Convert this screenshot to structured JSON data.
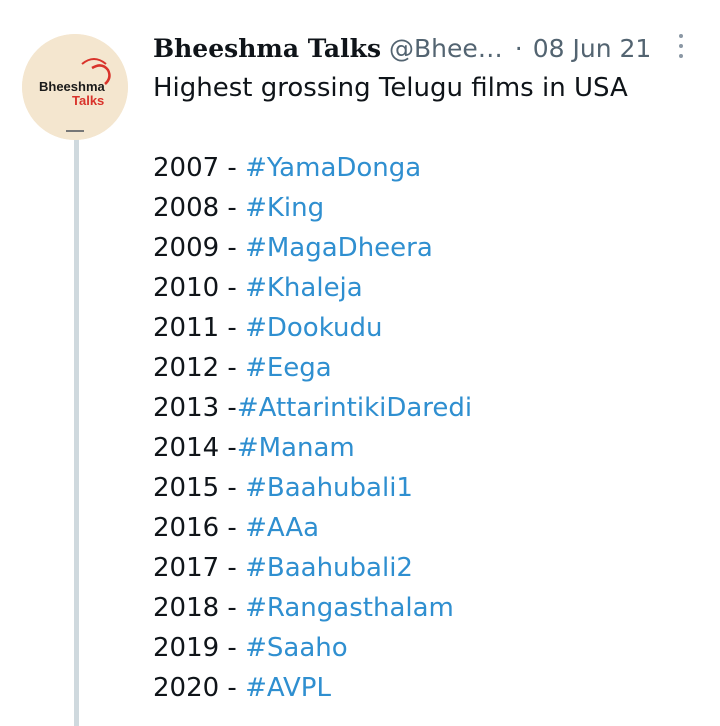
{
  "author": {
    "name": "Bheeshma Talks",
    "handle": "@Bhee…",
    "separator": "·",
    "date": "08 Jun 21",
    "avatar_text_line1": "Bheeshma",
    "avatar_text_line2": "Talks"
  },
  "tweet": {
    "heading": "Highest grossing Telugu films in USA",
    "entries": [
      {
        "year": "2007 - ",
        "tag": "#YamaDonga"
      },
      {
        "year": "2008 - ",
        "tag": "#King"
      },
      {
        "year": "2009 - ",
        "tag": "#MagaDheera"
      },
      {
        "year": "2010 - ",
        "tag": "#Khaleja"
      },
      {
        "year": "2011 - ",
        "tag": "#Dookudu"
      },
      {
        "year": "2012 - ",
        "tag": "#Eega"
      },
      {
        "year": "2013 -",
        "tag": "#AttarintikiDaredi"
      },
      {
        "year": "2014 -",
        "tag": "#Manam"
      },
      {
        "year": "2015 - ",
        "tag": "#Baahubali1"
      },
      {
        "year": "2016 - ",
        "tag": "#AAa"
      },
      {
        "year": "2017 - ",
        "tag": "#Baahubali2"
      },
      {
        "year": "2018 - ",
        "tag": "#Rangasthalam"
      },
      {
        "year": "2019 - ",
        "tag": "#Saaho"
      },
      {
        "year": "2020 - ",
        "tag": "#AVPL"
      }
    ]
  },
  "icons": {
    "more": "more-vertical-icon"
  },
  "colors": {
    "hashtag": "#2f8fd0",
    "text": "#0f1419",
    "muted": "#536471",
    "thread_line": "#cfd9de",
    "avatar_bg": "#f4e6cf"
  }
}
